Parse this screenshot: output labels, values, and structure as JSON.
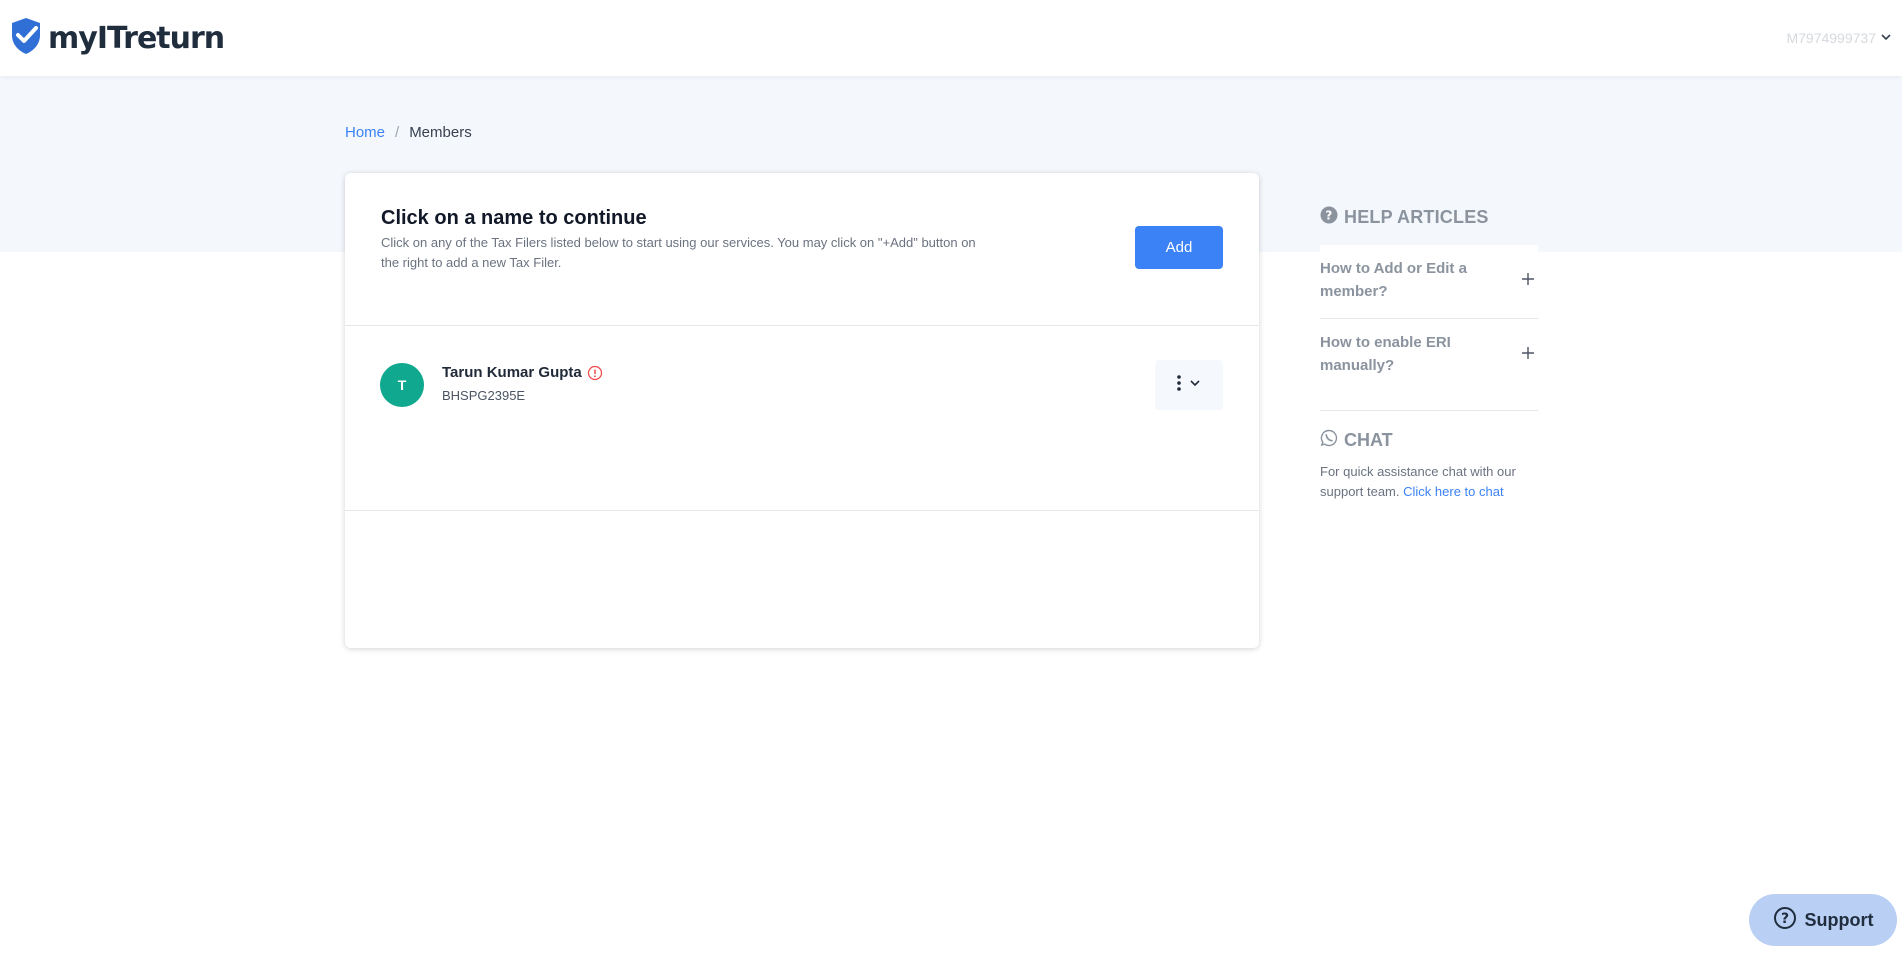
{
  "brand": {
    "name": "myITreturn",
    "accent": "#3b82f6",
    "logo_blue": "#2f6fd6"
  },
  "header": {
    "user_label": "M7974999737",
    "dropdown_icon": "chevron-down-icon"
  },
  "breadcrumb": {
    "home": "Home",
    "separator": "/",
    "current": "Members"
  },
  "card": {
    "title": "Click on a name to continue",
    "description": "Click on any of the Tax Filers listed below to start using our services. You may click on \"+Add\" button on the right to add a new Tax Filer.",
    "add_label": "Add"
  },
  "members": [
    {
      "initial": "T",
      "name": "Tarun Kumar Gupta",
      "pan": "BHSPG2395E",
      "avatar_color": "#10a88e",
      "status_icon": "warning-icon"
    }
  ],
  "help": {
    "title": "HELP ARTICLES",
    "articles": [
      {
        "question": "How to Add or Edit a member?"
      },
      {
        "question": "How to enable ERI manually?"
      }
    ],
    "chat_title": "CHAT",
    "chat_text": "For quick assistance chat with our support team.",
    "chat_link": "Click here to chat"
  },
  "support": {
    "label": "Support"
  }
}
